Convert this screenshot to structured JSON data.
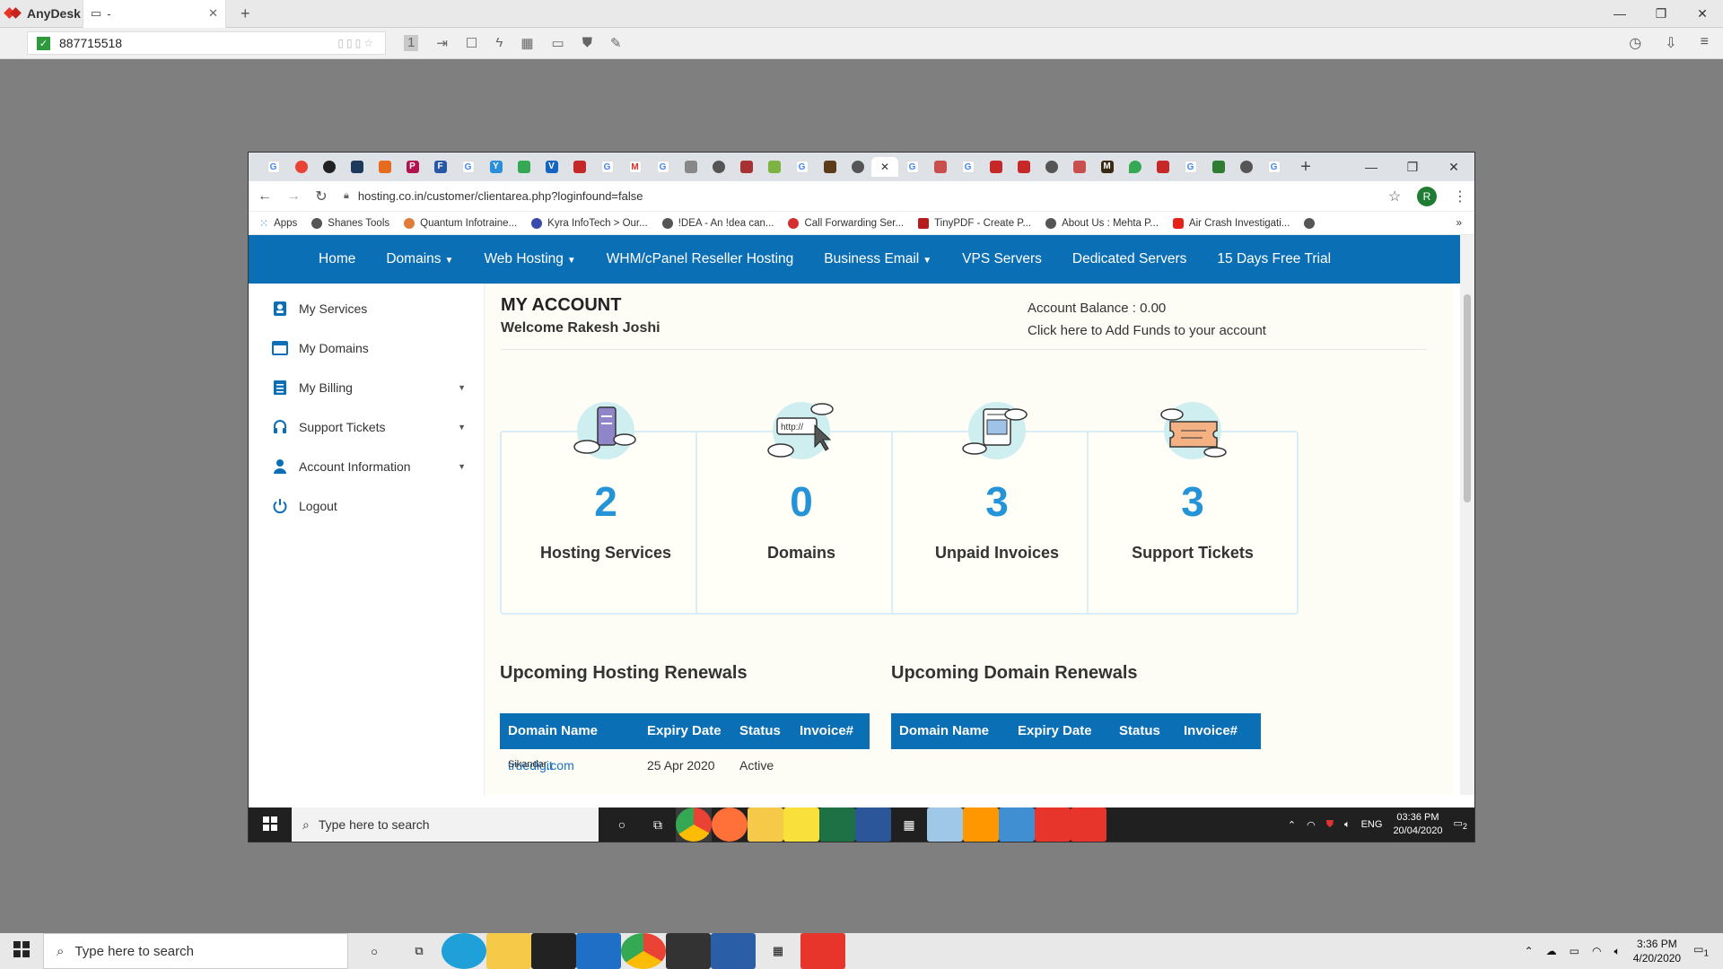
{
  "anydesk": {
    "app_name": "AnyDesk",
    "tab_label": "-",
    "address": "887715518"
  },
  "browser": {
    "url": "hosting.co.in/customer/clientarea.php?loginfound=false",
    "profile_initial": "R",
    "bookmarks": [
      "Apps",
      "Shanes Tools",
      "Quantum Infotraine...",
      "Kyra InfoTech > Our...",
      "!DEA - An !dea can...",
      "Call Forwarding Ser...",
      "TinyPDF - Create P...",
      "About Us : Mehta P...",
      "Air Crash Investigati..."
    ]
  },
  "nav": {
    "items": [
      "Home",
      "Domains",
      "Web Hosting",
      "WHM/cPanel Reseller Hosting",
      "Business Email",
      "VPS Servers",
      "Dedicated Servers",
      "15 Days Free Trial"
    ]
  },
  "sidebar": {
    "items": [
      "My Services",
      "My Domains",
      "My Billing",
      "Support Tickets",
      "Account Information",
      "Logout"
    ]
  },
  "account": {
    "title": "MY ACCOUNT",
    "welcome": "Welcome Rakesh Joshi",
    "balance": "Account Balance : 0.00",
    "add_funds": "Click here to Add Funds to your account"
  },
  "cards": [
    {
      "value": "2",
      "label": "Hosting Services"
    },
    {
      "value": "0",
      "label": "Domains"
    },
    {
      "value": "3",
      "label": "Unpaid Invoices"
    },
    {
      "value": "3",
      "label": "Support Tickets"
    }
  ],
  "hosting_renewals": {
    "title": "Upcoming Hosting Renewals",
    "columns": [
      "Domain Name",
      "Expiry Date",
      "Status",
      "Invoice#"
    ],
    "rows": [
      {
        "domain": "truedigit",
        "domain_tail": ".com",
        "overlay": "Sikandar",
        "expiry": "25 Apr 2020",
        "status": "Active"
      }
    ]
  },
  "domain_renewals": {
    "title": "Upcoming Domain Renewals",
    "columns": [
      "Domain Name",
      "Expiry Date",
      "Status",
      "Invoice#"
    ]
  },
  "remote_taskbar": {
    "search_placeholder": "Type here to search",
    "lang": "ENG",
    "time": "03:36 PM",
    "date": "20/04/2020",
    "notifications": "2"
  },
  "host_taskbar": {
    "search_placeholder": "Type here to search",
    "time": "3:36 PM",
    "date": "4/20/2020",
    "notifications": "1"
  }
}
